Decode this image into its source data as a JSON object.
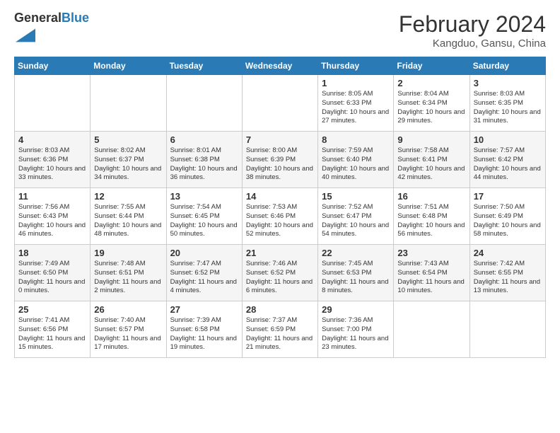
{
  "logo": {
    "line1": "General",
    "line2": "Blue"
  },
  "title": "February 2024",
  "location": "Kangduo, Gansu, China",
  "days_of_week": [
    "Sunday",
    "Monday",
    "Tuesday",
    "Wednesday",
    "Thursday",
    "Friday",
    "Saturday"
  ],
  "weeks": [
    [
      {
        "num": "",
        "info": ""
      },
      {
        "num": "",
        "info": ""
      },
      {
        "num": "",
        "info": ""
      },
      {
        "num": "",
        "info": ""
      },
      {
        "num": "1",
        "info": "Sunrise: 8:05 AM\nSunset: 6:33 PM\nDaylight: 10 hours and 27 minutes."
      },
      {
        "num": "2",
        "info": "Sunrise: 8:04 AM\nSunset: 6:34 PM\nDaylight: 10 hours and 29 minutes."
      },
      {
        "num": "3",
        "info": "Sunrise: 8:03 AM\nSunset: 6:35 PM\nDaylight: 10 hours and 31 minutes."
      }
    ],
    [
      {
        "num": "4",
        "info": "Sunrise: 8:03 AM\nSunset: 6:36 PM\nDaylight: 10 hours and 33 minutes."
      },
      {
        "num": "5",
        "info": "Sunrise: 8:02 AM\nSunset: 6:37 PM\nDaylight: 10 hours and 34 minutes."
      },
      {
        "num": "6",
        "info": "Sunrise: 8:01 AM\nSunset: 6:38 PM\nDaylight: 10 hours and 36 minutes."
      },
      {
        "num": "7",
        "info": "Sunrise: 8:00 AM\nSunset: 6:39 PM\nDaylight: 10 hours and 38 minutes."
      },
      {
        "num": "8",
        "info": "Sunrise: 7:59 AM\nSunset: 6:40 PM\nDaylight: 10 hours and 40 minutes."
      },
      {
        "num": "9",
        "info": "Sunrise: 7:58 AM\nSunset: 6:41 PM\nDaylight: 10 hours and 42 minutes."
      },
      {
        "num": "10",
        "info": "Sunrise: 7:57 AM\nSunset: 6:42 PM\nDaylight: 10 hours and 44 minutes."
      }
    ],
    [
      {
        "num": "11",
        "info": "Sunrise: 7:56 AM\nSunset: 6:43 PM\nDaylight: 10 hours and 46 minutes."
      },
      {
        "num": "12",
        "info": "Sunrise: 7:55 AM\nSunset: 6:44 PM\nDaylight: 10 hours and 48 minutes."
      },
      {
        "num": "13",
        "info": "Sunrise: 7:54 AM\nSunset: 6:45 PM\nDaylight: 10 hours and 50 minutes."
      },
      {
        "num": "14",
        "info": "Sunrise: 7:53 AM\nSunset: 6:46 PM\nDaylight: 10 hours and 52 minutes."
      },
      {
        "num": "15",
        "info": "Sunrise: 7:52 AM\nSunset: 6:47 PM\nDaylight: 10 hours and 54 minutes."
      },
      {
        "num": "16",
        "info": "Sunrise: 7:51 AM\nSunset: 6:48 PM\nDaylight: 10 hours and 56 minutes."
      },
      {
        "num": "17",
        "info": "Sunrise: 7:50 AM\nSunset: 6:49 PM\nDaylight: 10 hours and 58 minutes."
      }
    ],
    [
      {
        "num": "18",
        "info": "Sunrise: 7:49 AM\nSunset: 6:50 PM\nDaylight: 11 hours and 0 minutes."
      },
      {
        "num": "19",
        "info": "Sunrise: 7:48 AM\nSunset: 6:51 PM\nDaylight: 11 hours and 2 minutes."
      },
      {
        "num": "20",
        "info": "Sunrise: 7:47 AM\nSunset: 6:52 PM\nDaylight: 11 hours and 4 minutes."
      },
      {
        "num": "21",
        "info": "Sunrise: 7:46 AM\nSunset: 6:52 PM\nDaylight: 11 hours and 6 minutes."
      },
      {
        "num": "22",
        "info": "Sunrise: 7:45 AM\nSunset: 6:53 PM\nDaylight: 11 hours and 8 minutes."
      },
      {
        "num": "23",
        "info": "Sunrise: 7:43 AM\nSunset: 6:54 PM\nDaylight: 11 hours and 10 minutes."
      },
      {
        "num": "24",
        "info": "Sunrise: 7:42 AM\nSunset: 6:55 PM\nDaylight: 11 hours and 13 minutes."
      }
    ],
    [
      {
        "num": "25",
        "info": "Sunrise: 7:41 AM\nSunset: 6:56 PM\nDaylight: 11 hours and 15 minutes."
      },
      {
        "num": "26",
        "info": "Sunrise: 7:40 AM\nSunset: 6:57 PM\nDaylight: 11 hours and 17 minutes."
      },
      {
        "num": "27",
        "info": "Sunrise: 7:39 AM\nSunset: 6:58 PM\nDaylight: 11 hours and 19 minutes."
      },
      {
        "num": "28",
        "info": "Sunrise: 7:37 AM\nSunset: 6:59 PM\nDaylight: 11 hours and 21 minutes."
      },
      {
        "num": "29",
        "info": "Sunrise: 7:36 AM\nSunset: 7:00 PM\nDaylight: 11 hours and 23 minutes."
      },
      {
        "num": "",
        "info": ""
      },
      {
        "num": "",
        "info": ""
      }
    ]
  ]
}
